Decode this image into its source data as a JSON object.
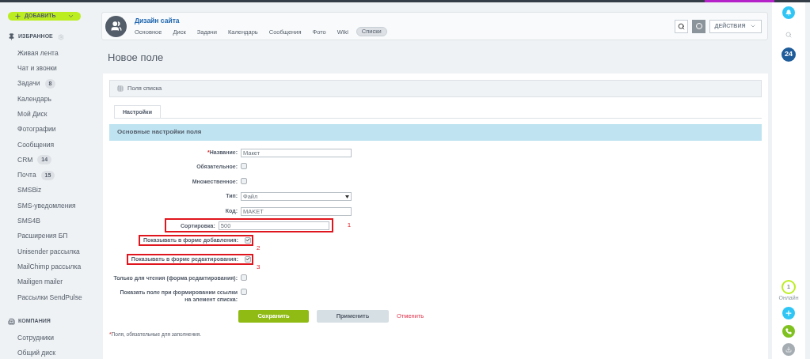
{
  "add_button": {
    "label": "ДОБАВИТЬ"
  },
  "sidebar": {
    "sections": [
      {
        "title": "ИЗБРАННОЕ",
        "kind": "favorites",
        "items": [
          {
            "label": "Живая лента"
          },
          {
            "label": "Чат и звонки"
          },
          {
            "label": "Задачи",
            "count": "8"
          },
          {
            "label": "Календарь"
          },
          {
            "label": "Мой Диск"
          },
          {
            "label": "Фотографии"
          },
          {
            "label": "Сообщения"
          },
          {
            "label": "CRM",
            "count": "14"
          },
          {
            "label": "Почта",
            "count": "15"
          },
          {
            "label": "SMSBiz"
          },
          {
            "label": "SMS-уведомления"
          },
          {
            "label": "SMS4B"
          },
          {
            "label": "Расширения БП"
          },
          {
            "label": "Unisender рассылка"
          },
          {
            "label": "MailChimp рассылка"
          },
          {
            "label": "Mailigen mailer"
          },
          {
            "label": "Рассылки SendPulse"
          }
        ]
      },
      {
        "title": "КОМПАНИЯ",
        "kind": "company",
        "items": [
          {
            "label": "Сотрудники"
          },
          {
            "label": "Общий диск"
          }
        ]
      }
    ]
  },
  "group": {
    "title": "Дизайн сайта",
    "tabs": [
      {
        "label": "Основное",
        "selected": false
      },
      {
        "label": "Диск",
        "selected": false
      },
      {
        "label": "Задачи",
        "selected": false
      },
      {
        "label": "Календарь",
        "selected": false
      },
      {
        "label": "Сообщения",
        "selected": false
      },
      {
        "label": "Фото",
        "selected": false
      },
      {
        "label": "Wiki",
        "selected": false
      },
      {
        "label": "Списки",
        "selected": true
      }
    ],
    "actions_label": "ДЕЙСТВИЯ"
  },
  "page_title": "Новое поле",
  "list_fields_link": "Поля списка",
  "tabs": [
    {
      "label": "Настройки",
      "selected": true
    }
  ],
  "section_title": "Основные настройки поля",
  "form": [
    {
      "kind": "text",
      "label": "Название:",
      "required": true,
      "value": "Макет"
    },
    {
      "kind": "checkbox",
      "label": "Обязательное:",
      "checked": false
    },
    {
      "kind": "checkbox",
      "label": "Множественное:",
      "checked": false
    },
    {
      "kind": "select",
      "label": "Тип:",
      "value": "Файл"
    },
    {
      "kind": "text",
      "label": "Код:",
      "value": "MAKET"
    },
    {
      "kind": "text",
      "label": "Сортировка:",
      "value": "500",
      "marker": "1"
    },
    {
      "kind": "checkbox",
      "label": "Показывать в форме добавления:",
      "checked": true,
      "marker": "2"
    },
    {
      "kind": "checkbox",
      "label": "Показывать в форме редактирования:",
      "checked": true,
      "marker": "3"
    },
    {
      "kind": "checkbox",
      "label": "Только для чтения (форма редактирования):",
      "checked": false
    },
    {
      "kind": "checkbox",
      "label": "Показать поле при формировании ссылки на элемент списка:",
      "checked": false
    }
  ],
  "buttons": {
    "save": "Сохранить",
    "apply": "Применить",
    "cancel": "Отменить"
  },
  "required_mark": "*",
  "footnote": "Поля, обязательные для заполнения.",
  "footnote_mark": "*",
  "right_rail": {
    "counter": "24",
    "online_count": "1",
    "online_label": "Онлайн"
  }
}
